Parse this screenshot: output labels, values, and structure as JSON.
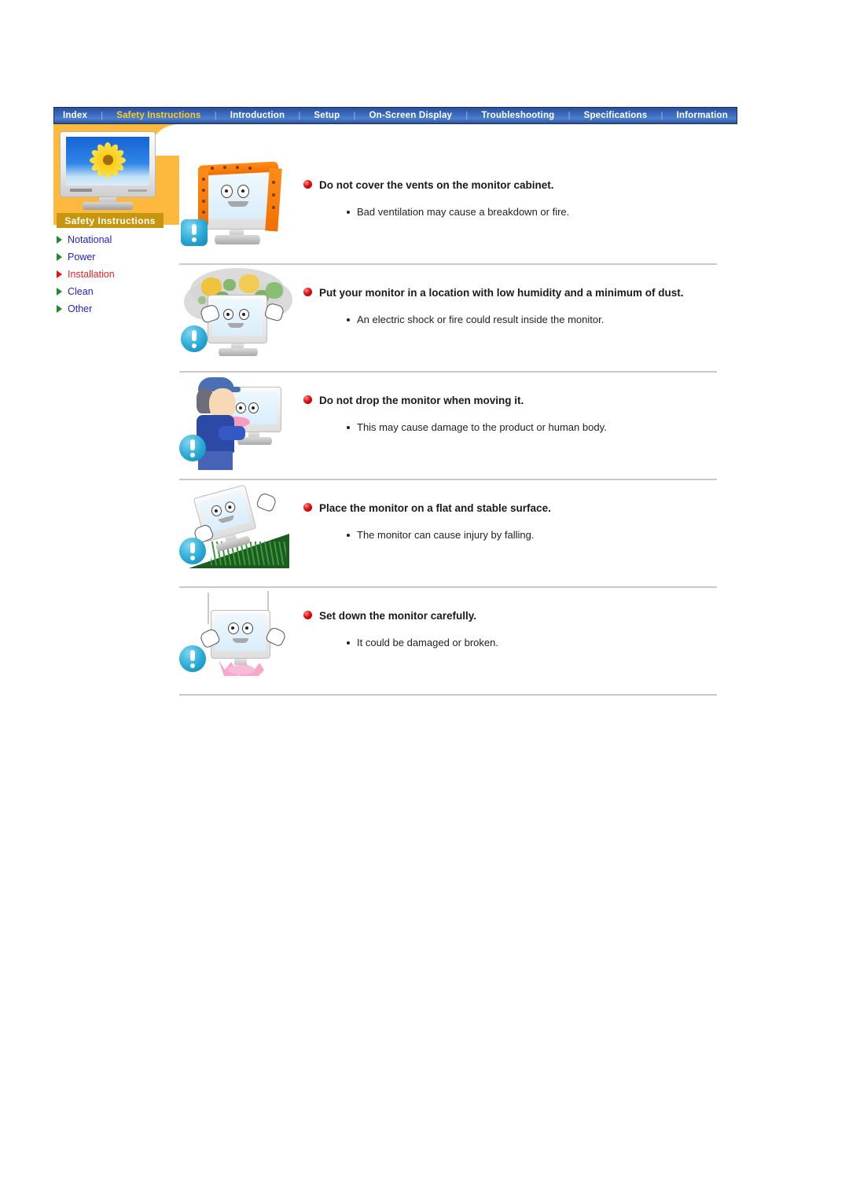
{
  "nav": {
    "separator": "|",
    "items": [
      {
        "label": "Index",
        "active": false
      },
      {
        "label": "Safety Instructions",
        "active": true
      },
      {
        "label": "Introduction",
        "active": false
      },
      {
        "label": "Setup",
        "active": false
      },
      {
        "label": "On-Screen Display",
        "active": false
      },
      {
        "label": "Troubleshooting",
        "active": false
      },
      {
        "label": "Specifications",
        "active": false
      },
      {
        "label": "Information",
        "active": false
      }
    ]
  },
  "sidebar": {
    "title": "Safety Instructions",
    "thumbnail_alt": "monitor-sunflower-thumbnail",
    "items": [
      {
        "label": "Notational",
        "current": false
      },
      {
        "label": "Power",
        "current": false
      },
      {
        "label": "Installation",
        "current": true
      },
      {
        "label": "Clean",
        "current": false
      },
      {
        "label": "Other",
        "current": false
      }
    ]
  },
  "sections": [
    {
      "heading": "Do not cover the vents on the monitor cabinet.",
      "bullet": "Bad ventilation may cause a breakdown or fire.",
      "figure": "monitor-covered-by-cloth"
    },
    {
      "heading": "Put your monitor in a location with low humidity and a minimum of dust.",
      "bullet": "An electric shock or fire could result inside the monitor.",
      "figure": "monitor-in-dust-cloud"
    },
    {
      "heading": "Do not drop the monitor when moving it.",
      "bullet": "This may cause damage to the product or human body.",
      "figure": "person-carrying-monitor"
    },
    {
      "heading": "Place the monitor on a flat and stable surface.",
      "bullet": "The monitor can cause injury by falling.",
      "figure": "monitor-on-slope"
    },
    {
      "heading": "Set down the monitor carefully.",
      "bullet": "It could be damaged or broken.",
      "figure": "monitor-dropping-impact"
    }
  ],
  "colors": {
    "nav_background": "#2b4f9e",
    "nav_active_text": "#ffcc22",
    "sidebar_background": "#fcb93d",
    "sidebar_title_background": "#c7960f",
    "link_blue": "#2222cc",
    "link_current_red": "#ee2222",
    "triangle_green": "#1f8a2e",
    "warning_badge": "#29a9d6",
    "heading_bullet_red": "#e01010"
  }
}
